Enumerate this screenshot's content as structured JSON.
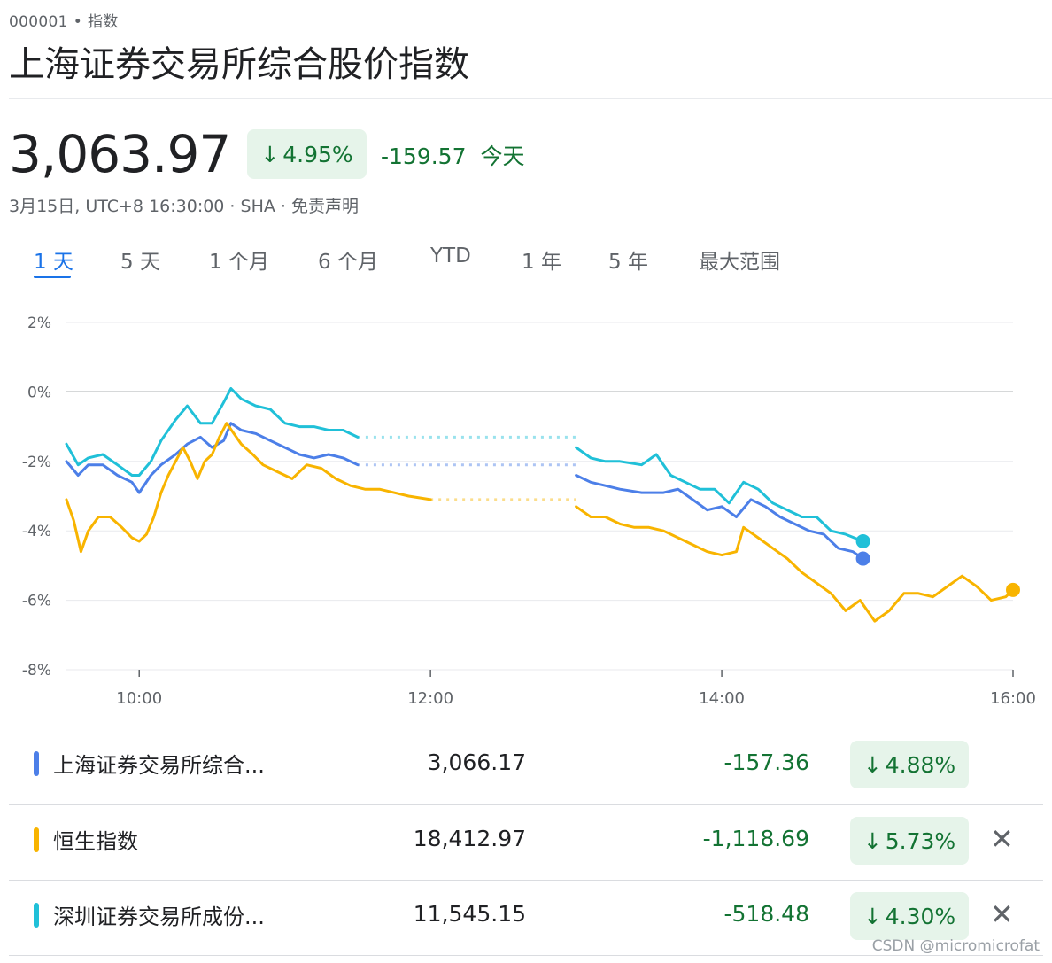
{
  "header": {
    "ticker_code": "000001",
    "ticker_sep": "•",
    "ticker_type": "指数",
    "title": "上海证券交易所综合股价指数"
  },
  "quote": {
    "price": "3,063.97",
    "pct_arrow": "↓",
    "pct": "4.95%",
    "change": "-159.57",
    "period": "今天",
    "meta": "3月15日, UTC+8 16:30:00 · SHA · 免责声明"
  },
  "tabs": [
    {
      "label": "1 天",
      "active": true
    },
    {
      "label": "5 天"
    },
    {
      "label": "1 个月"
    },
    {
      "label": "6 个月"
    },
    {
      "label": "YTD"
    },
    {
      "label": "1 年"
    },
    {
      "label": "5 年"
    },
    {
      "label": "最大范围"
    }
  ],
  "colors": {
    "blue": "#4c7fe8",
    "yellow": "#f8b400",
    "cyan": "#20c0d8",
    "negative": "#137333",
    "badge_bg": "#e6f4ea",
    "accent": "#1a73e8"
  },
  "chart_data": {
    "type": "line",
    "x_ticks": [
      "10:00",
      "12:00",
      "14:00",
      "16:00"
    ],
    "y_ticks": [
      "2%",
      "0%",
      "-2%",
      "-4%",
      "-6%",
      "-8%"
    ],
    "ylim": [
      -8,
      2
    ],
    "xlim_hours": [
      9.5,
      16.0
    ],
    "grid": true,
    "series": [
      {
        "name": "上海证券交易所综合股价指数",
        "color": "blue",
        "gap": [
          11.5,
          13.0
        ],
        "points": [
          [
            9.5,
            -2.0
          ],
          [
            9.58,
            -2.4
          ],
          [
            9.65,
            -2.1
          ],
          [
            9.75,
            -2.1
          ],
          [
            9.85,
            -2.4
          ],
          [
            9.95,
            -2.6
          ],
          [
            10.0,
            -2.9
          ],
          [
            10.08,
            -2.4
          ],
          [
            10.15,
            -2.1
          ],
          [
            10.25,
            -1.8
          ],
          [
            10.33,
            -1.5
          ],
          [
            10.42,
            -1.3
          ],
          [
            10.5,
            -1.6
          ],
          [
            10.58,
            -1.4
          ],
          [
            10.63,
            -0.9
          ],
          [
            10.7,
            -1.1
          ],
          [
            10.8,
            -1.2
          ],
          [
            10.9,
            -1.4
          ],
          [
            11.0,
            -1.6
          ],
          [
            11.1,
            -1.8
          ],
          [
            11.2,
            -1.9
          ],
          [
            11.3,
            -1.8
          ],
          [
            11.4,
            -1.9
          ],
          [
            11.5,
            -2.1
          ],
          [
            13.0,
            -2.4
          ],
          [
            13.1,
            -2.6
          ],
          [
            13.2,
            -2.7
          ],
          [
            13.3,
            -2.8
          ],
          [
            13.45,
            -2.9
          ],
          [
            13.6,
            -2.9
          ],
          [
            13.7,
            -2.8
          ],
          [
            13.8,
            -3.1
          ],
          [
            13.9,
            -3.4
          ],
          [
            14.0,
            -3.3
          ],
          [
            14.1,
            -3.6
          ],
          [
            14.2,
            -3.1
          ],
          [
            14.3,
            -3.3
          ],
          [
            14.4,
            -3.6
          ],
          [
            14.5,
            -3.8
          ],
          [
            14.6,
            -4.0
          ],
          [
            14.7,
            -4.1
          ],
          [
            14.8,
            -4.5
          ],
          [
            14.9,
            -4.6
          ],
          [
            14.97,
            -4.8
          ]
        ]
      },
      {
        "name": "恒生指数",
        "color": "yellow",
        "gap": [
          12.0,
          13.0
        ],
        "points": [
          [
            9.5,
            -3.1
          ],
          [
            9.55,
            -3.7
          ],
          [
            9.6,
            -4.6
          ],
          [
            9.65,
            -4.0
          ],
          [
            9.72,
            -3.6
          ],
          [
            9.8,
            -3.6
          ],
          [
            9.88,
            -3.9
          ],
          [
            9.95,
            -4.2
          ],
          [
            10.0,
            -4.3
          ],
          [
            10.05,
            -4.1
          ],
          [
            10.1,
            -3.6
          ],
          [
            10.15,
            -2.9
          ],
          [
            10.2,
            -2.4
          ],
          [
            10.25,
            -2.0
          ],
          [
            10.3,
            -1.6
          ],
          [
            10.35,
            -2.0
          ],
          [
            10.4,
            -2.5
          ],
          [
            10.45,
            -2.0
          ],
          [
            10.5,
            -1.8
          ],
          [
            10.55,
            -1.3
          ],
          [
            10.6,
            -0.9
          ],
          [
            10.65,
            -1.2
          ],
          [
            10.7,
            -1.5
          ],
          [
            10.78,
            -1.8
          ],
          [
            10.85,
            -2.1
          ],
          [
            10.95,
            -2.3
          ],
          [
            11.05,
            -2.5
          ],
          [
            11.15,
            -2.1
          ],
          [
            11.25,
            -2.2
          ],
          [
            11.35,
            -2.5
          ],
          [
            11.45,
            -2.7
          ],
          [
            11.55,
            -2.8
          ],
          [
            11.65,
            -2.8
          ],
          [
            11.75,
            -2.9
          ],
          [
            11.85,
            -3.0
          ],
          [
            12.0,
            -3.1
          ],
          [
            13.0,
            -3.3
          ],
          [
            13.1,
            -3.6
          ],
          [
            13.2,
            -3.6
          ],
          [
            13.3,
            -3.8
          ],
          [
            13.4,
            -3.9
          ],
          [
            13.5,
            -3.9
          ],
          [
            13.6,
            -4.0
          ],
          [
            13.7,
            -4.2
          ],
          [
            13.8,
            -4.4
          ],
          [
            13.9,
            -4.6
          ],
          [
            14.0,
            -4.7
          ],
          [
            14.1,
            -4.6
          ],
          [
            14.15,
            -3.9
          ],
          [
            14.25,
            -4.2
          ],
          [
            14.35,
            -4.5
          ],
          [
            14.45,
            -4.8
          ],
          [
            14.55,
            -5.2
          ],
          [
            14.65,
            -5.5
          ],
          [
            14.75,
            -5.8
          ],
          [
            14.85,
            -6.3
          ],
          [
            14.95,
            -6.0
          ],
          [
            15.05,
            -6.6
          ],
          [
            15.15,
            -6.3
          ],
          [
            15.25,
            -5.8
          ],
          [
            15.35,
            -5.8
          ],
          [
            15.45,
            -5.9
          ],
          [
            15.55,
            -5.6
          ],
          [
            15.65,
            -5.3
          ],
          [
            15.75,
            -5.6
          ],
          [
            15.85,
            -6.0
          ],
          [
            15.95,
            -5.9
          ],
          [
            16.0,
            -5.7
          ]
        ]
      },
      {
        "name": "深圳证券交易所成份股价指数",
        "color": "cyan",
        "gap": [
          11.5,
          13.0
        ],
        "points": [
          [
            9.5,
            -1.5
          ],
          [
            9.58,
            -2.1
          ],
          [
            9.65,
            -1.9
          ],
          [
            9.75,
            -1.8
          ],
          [
            9.85,
            -2.1
          ],
          [
            9.95,
            -2.4
          ],
          [
            10.0,
            -2.4
          ],
          [
            10.08,
            -2.0
          ],
          [
            10.15,
            -1.4
          ],
          [
            10.25,
            -0.8
          ],
          [
            10.33,
            -0.4
          ],
          [
            10.42,
            -0.9
          ],
          [
            10.5,
            -0.9
          ],
          [
            10.58,
            -0.3
          ],
          [
            10.63,
            0.1
          ],
          [
            10.7,
            -0.2
          ],
          [
            10.8,
            -0.4
          ],
          [
            10.9,
            -0.5
          ],
          [
            11.0,
            -0.9
          ],
          [
            11.1,
            -1.0
          ],
          [
            11.2,
            -1.0
          ],
          [
            11.3,
            -1.1
          ],
          [
            11.4,
            -1.1
          ],
          [
            11.5,
            -1.3
          ],
          [
            13.0,
            -1.6
          ],
          [
            13.1,
            -1.9
          ],
          [
            13.2,
            -2.0
          ],
          [
            13.3,
            -2.0
          ],
          [
            13.45,
            -2.1
          ],
          [
            13.55,
            -1.8
          ],
          [
            13.65,
            -2.4
          ],
          [
            13.75,
            -2.6
          ],
          [
            13.85,
            -2.8
          ],
          [
            13.95,
            -2.8
          ],
          [
            14.05,
            -3.2
          ],
          [
            14.15,
            -2.6
          ],
          [
            14.25,
            -2.8
          ],
          [
            14.35,
            -3.2
          ],
          [
            14.45,
            -3.4
          ],
          [
            14.55,
            -3.6
          ],
          [
            14.65,
            -3.6
          ],
          [
            14.75,
            -4.0
          ],
          [
            14.85,
            -4.1
          ],
          [
            14.97,
            -4.3
          ]
        ]
      }
    ]
  },
  "comparisons": [
    {
      "name": "上海证券交易所综合...",
      "value": "3,066.17",
      "change": "-157.36",
      "arrow": "↓",
      "pct": "4.88%",
      "color": "blue",
      "close": ""
    },
    {
      "name": "恒生指数",
      "value": "18,412.97",
      "change": "-1,118.69",
      "arrow": "↓",
      "pct": "5.73%",
      "color": "yellow",
      "close": "✕"
    },
    {
      "name": "深圳证券交易所成份...",
      "value": "11,545.15",
      "change": "-518.48",
      "arrow": "↓",
      "pct": "4.30%",
      "color": "cyan",
      "close": "✕"
    }
  ],
  "watermark": "CSDN @micromicrofat"
}
